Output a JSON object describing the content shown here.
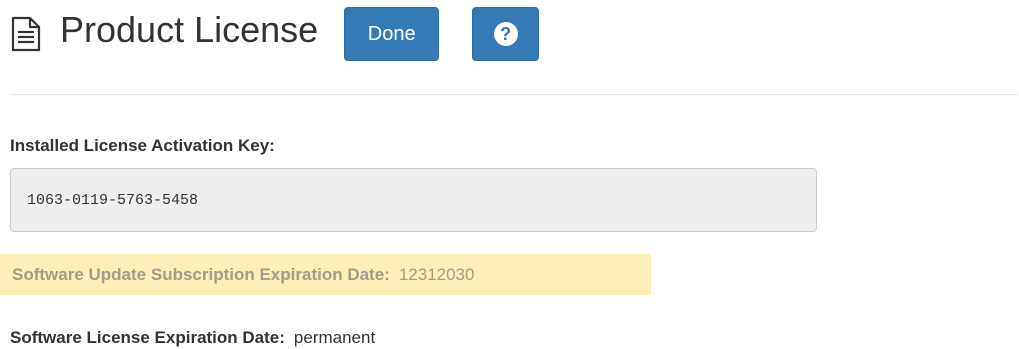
{
  "header": {
    "title": "Product License",
    "title_icon": "document-icon",
    "done_label": "Done",
    "help_label": "?"
  },
  "activation_key": {
    "label": "Installed License Activation Key:",
    "value": "1063-0119-5763-5458"
  },
  "subscription": {
    "label": "Software Update Subscription Expiration Date:",
    "value": "12312030",
    "highlight_color": "#fcf0b6"
  },
  "license": {
    "label": "Software License Expiration Date:",
    "value": "permanent"
  },
  "colors": {
    "primary_button": "#337ab7",
    "text": "#333333",
    "muted_text": "#a09e87"
  }
}
